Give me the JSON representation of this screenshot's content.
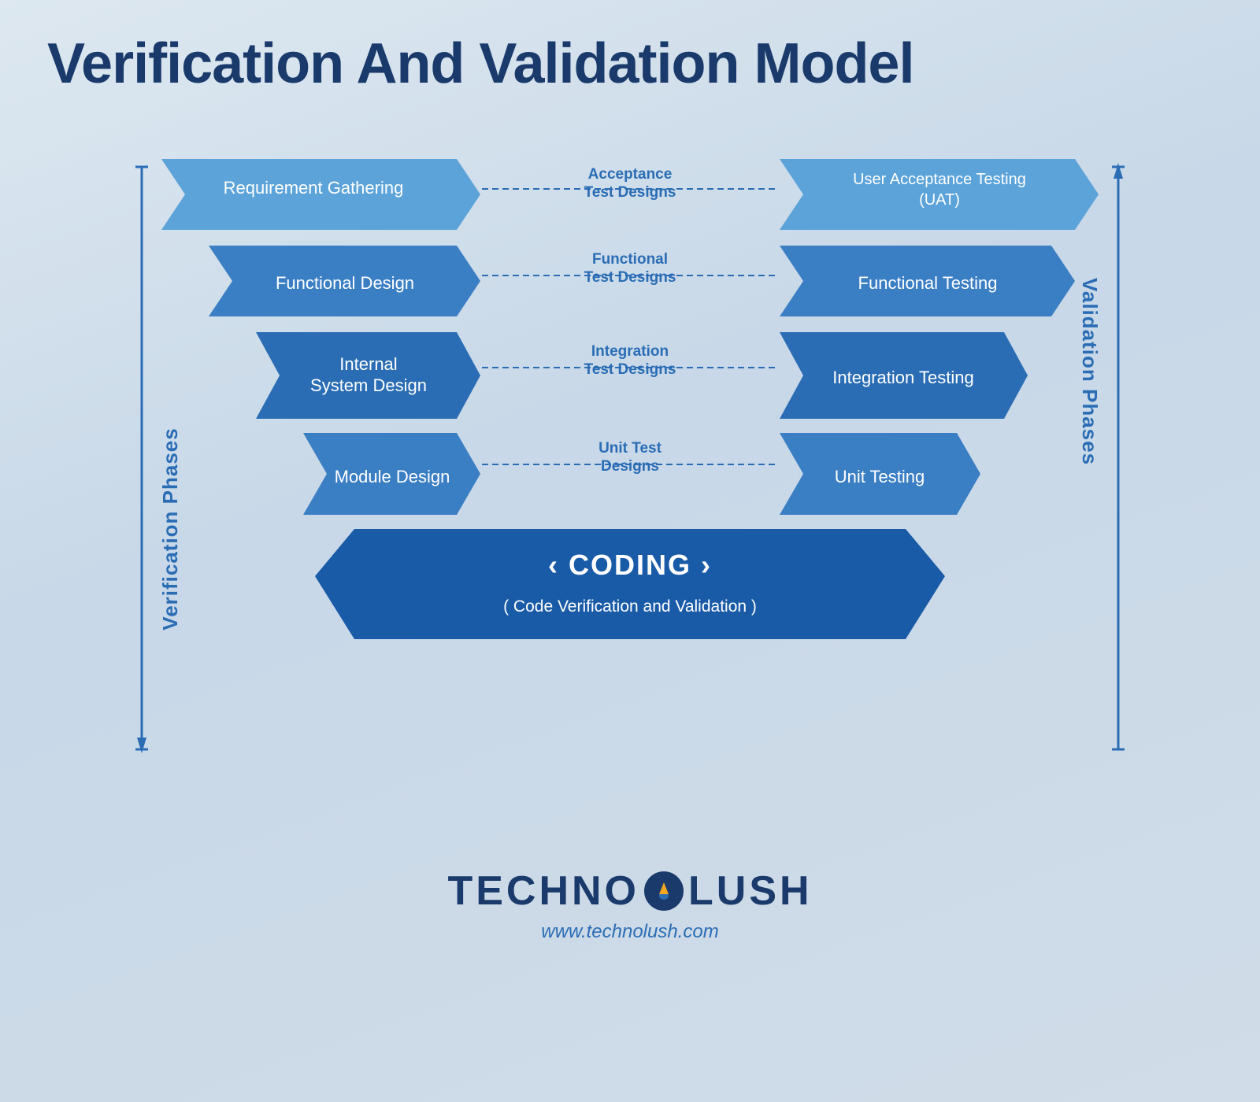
{
  "title": "Verification And Validation Model",
  "diagram": {
    "rows": [
      {
        "left_label": "Requirement Gathering",
        "middle_label": "Acceptance\nTest Designs",
        "right_label": "User Acceptance Testing\n(UAT)"
      },
      {
        "left_label": "Functional Design",
        "middle_label": "Functional\nTest Designs",
        "right_label": "Functional Testing"
      },
      {
        "left_label": "Internal\nSystem Design",
        "middle_label": "Integration\nTest Designs",
        "right_label": "Integration Testing"
      },
      {
        "left_label": "Module Design",
        "middle_label": "Unit Test\nDesigns",
        "right_label": "Unit Testing"
      }
    ],
    "coding_label": "< CODING >",
    "coding_sublabel": "( Code Verification and Validation )",
    "verification_phases": "Verification Phases",
    "validation_phases": "Validation Phases"
  },
  "logo": {
    "text_left": "TECHNO",
    "text_right": "LUSH",
    "url": "www.technolush.com"
  }
}
